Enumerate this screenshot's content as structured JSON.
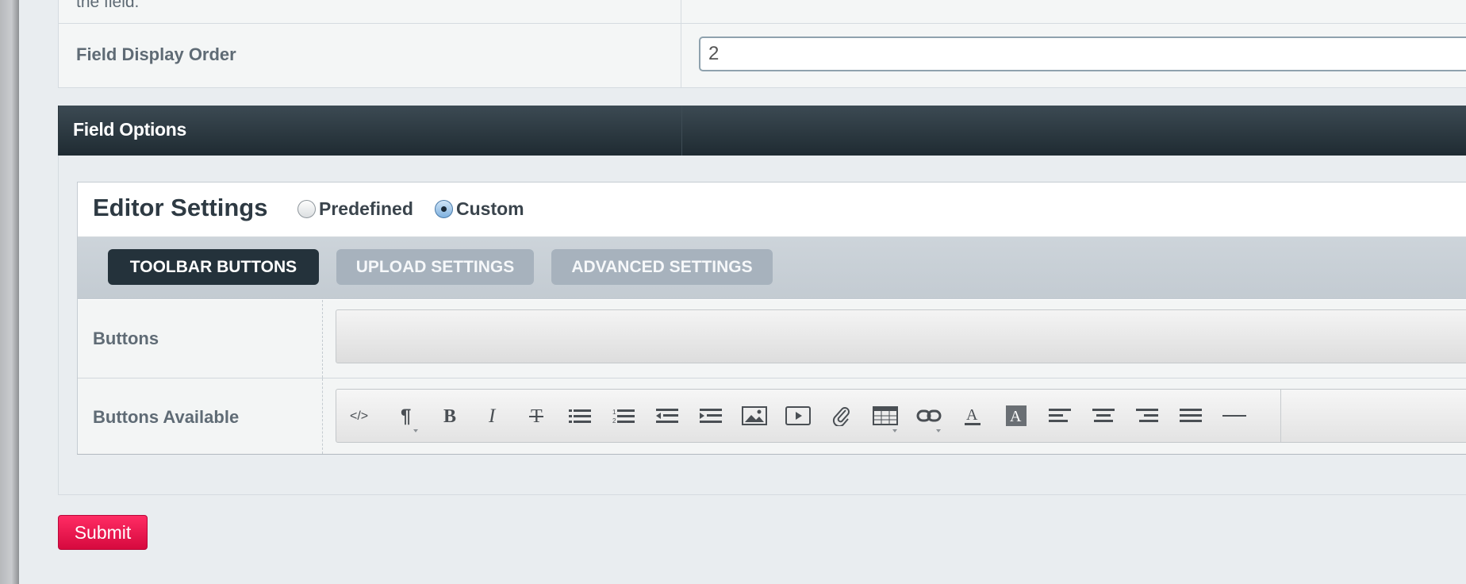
{
  "form": {
    "top_row_text": "the field.",
    "display_order_label": "Field Display Order",
    "display_order_value": "2"
  },
  "section": {
    "title": "Field Options"
  },
  "editor": {
    "title": "Editor Settings",
    "radio_predefined": "Predefined",
    "radio_custom": "Custom",
    "selected": "Custom",
    "tabs": [
      {
        "label": "TOOLBAR BUTTONS",
        "active": true
      },
      {
        "label": "UPLOAD SETTINGS",
        "active": false
      },
      {
        "label": "ADVANCED SETTINGS",
        "active": false
      }
    ],
    "buttons_label": "Buttons",
    "buttons_available_label": "Buttons Available",
    "toolbar_icons": [
      "html-code-icon",
      "paragraph-format-icon",
      "bold-icon",
      "italic-icon",
      "strikethrough-icon",
      "unordered-list-icon",
      "ordered-list-icon",
      "outdent-icon",
      "indent-icon",
      "image-icon",
      "video-icon",
      "file-attach-icon",
      "table-icon",
      "link-icon",
      "font-color-icon",
      "background-color-icon",
      "align-left-icon",
      "align-center-icon",
      "align-right-icon",
      "align-justify-icon",
      "horizontal-rule-icon"
    ]
  },
  "actions": {
    "submit_label": "Submit"
  },
  "colors": {
    "header_dark": "#24323b",
    "submit_red": "#e8124b",
    "tab_inactive": "#a7b2bd"
  }
}
